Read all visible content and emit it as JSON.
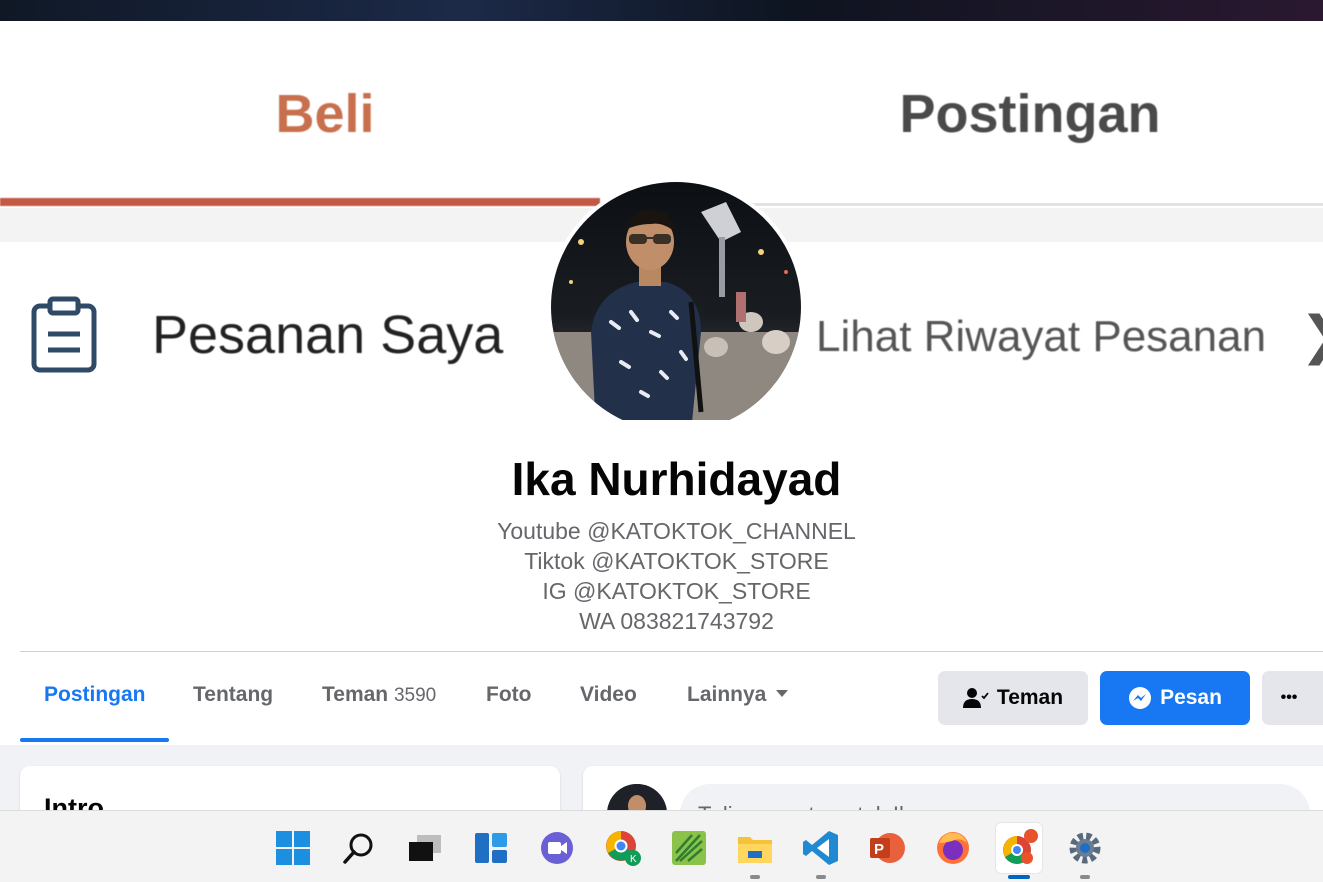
{
  "cover": {
    "tab_buy": "Beli",
    "tab_posts": "Postingan",
    "orders_label": "Pesanan Saya",
    "history_label": "Lihat Riwayat Pesanan",
    "history_chevron": "❯"
  },
  "profile": {
    "name": "Ika Nurhidayad",
    "bio": [
      "Youtube @KATOKTOK_CHANNEL",
      "Tiktok @KATOKTOK_STORE",
      "IG @KATOKTOK_STORE",
      "WA 083821743792"
    ]
  },
  "nav": {
    "tabs": [
      {
        "label": "Postingan",
        "count": "",
        "active": true
      },
      {
        "label": "Tentang",
        "count": ""
      },
      {
        "label": "Teman",
        "count": "3590"
      },
      {
        "label": "Foto",
        "count": ""
      },
      {
        "label": "Video",
        "count": ""
      },
      {
        "label": "Lainnya",
        "count": ""
      }
    ],
    "friend_button": "Teman",
    "message_button": "Pesan",
    "more_button": "•••"
  },
  "intro": {
    "title": "Intro"
  },
  "composer": {
    "placeholder": "Tulis sesuatu untuk Ika..."
  },
  "taskbar": {
    "icons": [
      "windows-start-icon",
      "search-icon",
      "task-view-icon",
      "widgets-icon",
      "teams-chat-icon",
      "chrome-profile-icon",
      "app-green-icon",
      "file-explorer-icon",
      "vscode-icon",
      "powerpoint-icon",
      "firefox-icon",
      "chrome-active-icon",
      "settings-icon"
    ]
  },
  "colors": {
    "facebook_blue": "#1877f2",
    "shopee_tab_orange": "#c45a45",
    "secondary_text": "#65676b"
  }
}
